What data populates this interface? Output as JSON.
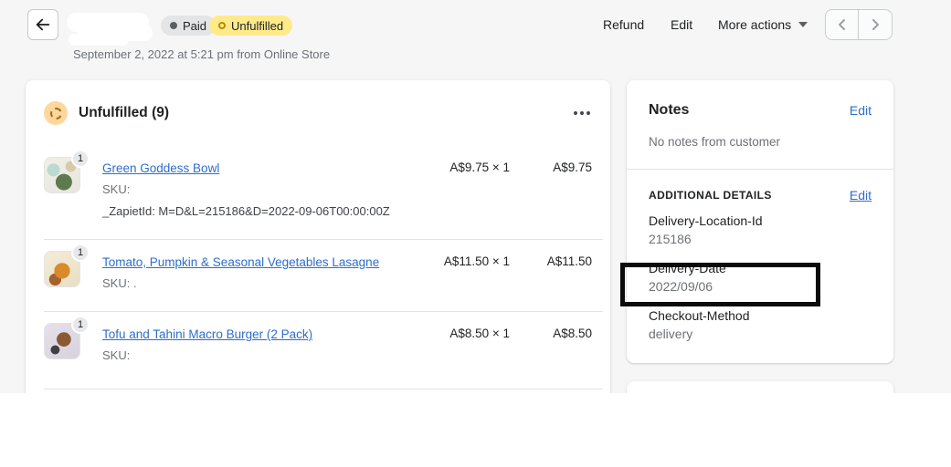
{
  "header": {
    "badges": [
      {
        "label": "Paid",
        "type": "paid"
      },
      {
        "label": "Unfulfilled",
        "type": "unfulfilled"
      }
    ],
    "actions": [
      {
        "label": "Refund"
      },
      {
        "label": "Edit"
      },
      {
        "label": "More actions"
      }
    ],
    "date_line": "September 2, 2022 at 5:21 pm from Online Store"
  },
  "fulfillment_card": {
    "title": "Unfulfilled (9)",
    "items": [
      {
        "qty": "1",
        "title": "Green Goddess Bowl",
        "sku_line": "SKU:",
        "property_line": "_ZapietId: M=D&L=215186&D=2022-09-06T00:00:00Z",
        "unit_price": "A$9.75 × 1",
        "total": "A$9.75"
      },
      {
        "qty": "1",
        "title": "Tomato, Pumpkin & Seasonal Vegetables Lasagne",
        "sku_line": "SKU: .",
        "unit_price": "A$11.50 × 1",
        "total": "A$11.50"
      },
      {
        "qty": "1",
        "title": "Tofu and Tahini Macro Burger (2 Pack)",
        "sku_line": "SKU:",
        "unit_price": "A$8.50 × 1",
        "total": "A$8.50"
      }
    ]
  },
  "notes_card": {
    "title": "Notes",
    "edit": "Edit",
    "empty_text": "No notes from customer",
    "additional": {
      "heading": "ADDITIONAL DETAILS",
      "edit": "Edit",
      "fields": [
        {
          "label": "Delivery-Location-Id",
          "value": "215186",
          "highlighted": false
        },
        {
          "label": "Delivery-Date",
          "value": "2022/09/06",
          "highlighted": true
        },
        {
          "label": "Checkout-Method",
          "value": "delivery",
          "highlighted": false
        }
      ]
    }
  },
  "colors": {
    "page_bg": "#f6f6f7",
    "card_bg": "#ffffff",
    "text": "#202223",
    "muted_text": "#6d7175",
    "link": "#2c6ecb",
    "badge_paid_bg": "#e4e5e7",
    "badge_unfulfilled_bg": "#ffea8a",
    "attention_icon_bg": "#ffd79d",
    "attention_icon_ring": "#9c6f19",
    "highlight_border": "#0b0b0b",
    "divider": "#e1e3e5"
  }
}
